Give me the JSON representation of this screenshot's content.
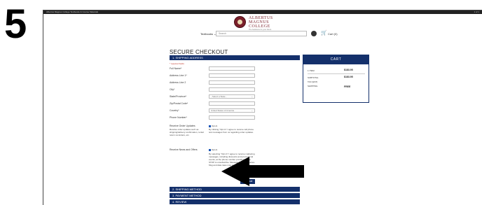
{
  "step": {
    "number": "5"
  },
  "browser": {
    "left_text": "Albertus Magnus College Textbooks & Course Materials",
    "right_text": "1 of 1"
  },
  "logo": {
    "line1": "ALBERTUS",
    "line2": "MAGNUS",
    "line3": "COLLEGE",
    "tagline": "The bookstore for your future"
  },
  "header": {
    "nav_textbooks": "Textbooks ⌄",
    "search_placeholder": "Search",
    "cart_label": "Cart (0)"
  },
  "checkout": {
    "title": "SECURE CHECKOUT",
    "required_note": "* required fields",
    "sections": [
      {
        "label": "1. SHIPPING ADDRESS"
      },
      {
        "label": "2. SHIPPING METHOD"
      },
      {
        "label": "3. PAYMENT METHOD"
      },
      {
        "label": "4. REVIEW"
      }
    ],
    "fields": [
      {
        "label": "Full Name*",
        "value": ""
      },
      {
        "label": "Address Line 1*",
        "value": ""
      },
      {
        "label": "Address Line 2",
        "value": ""
      },
      {
        "label": "City*",
        "value": ""
      },
      {
        "label": "State/Province*",
        "value": "- Select a State -"
      },
      {
        "label": "Zip/Postal Code*",
        "value": ""
      },
      {
        "label": "Country*",
        "value": "United States of America"
      },
      {
        "label": "Phone Number*",
        "value": ""
      }
    ],
    "order_updates": {
      "label": "Receive Order Updates",
      "sublabel": "Receive order updates such as shipping/delivery confirmation, rental return reminders, etc.",
      "checkbox_label": "Opt-In",
      "description": "By clicking \"Opt-In\" I agree to receive cell phone text messages from us regarding order updates."
    },
    "news_offers": {
      "label": "Receive News and Offers",
      "checkbox_label": "Opt-In",
      "description": "By selecting \"Opt-In\" I agree to receive marketing messages, including discounts and promotional events, at the phone number provided. Reply STOP to unsubscribe. Message frequency varies. Msg and data rates may apply."
    },
    "continue_label": "Continue"
  },
  "cart": {
    "title": "CART",
    "items_label": "1 ITEM",
    "items_value": "$183.95",
    "subtotal_label": "SUBTOTAL",
    "subtotal_value": "$183.95",
    "tax_label": "TAX (EST)",
    "shipping_label": "SHIPPING",
    "shipping_value": "FREE"
  }
}
